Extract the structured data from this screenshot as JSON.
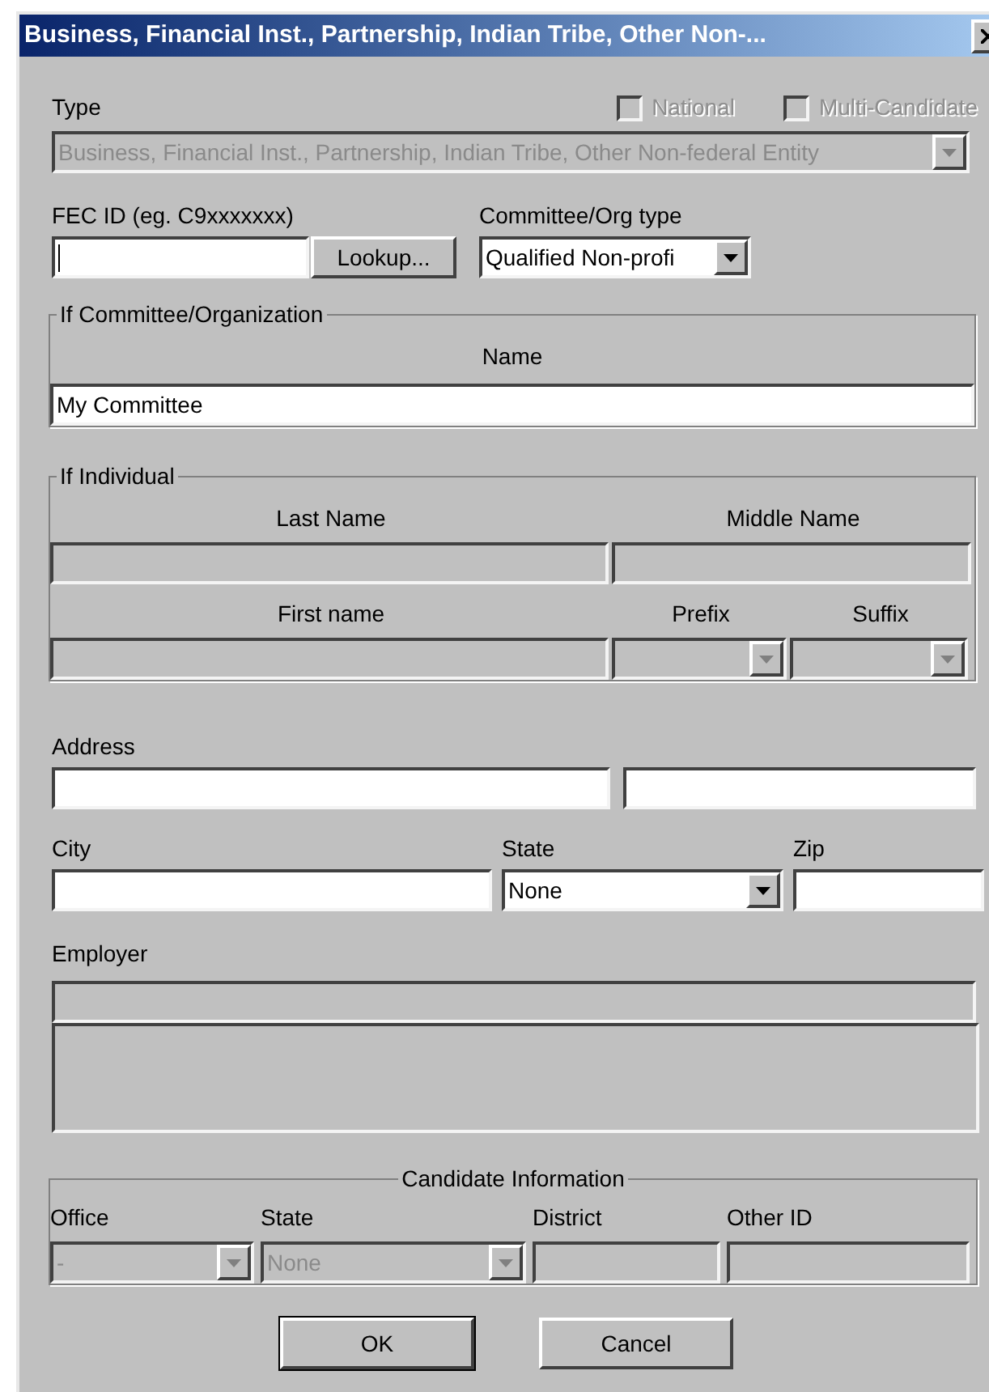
{
  "window": {
    "title": "Business, Financial Inst., Partnership, Indian Tribe, Other Non-..."
  },
  "type_section": {
    "label": "Type",
    "options": [
      {
        "label": "National",
        "checked": false,
        "disabled": true
      },
      {
        "label": "Multi-Candidate",
        "checked": false,
        "disabled": true
      }
    ],
    "field": {
      "kind": "dropdown",
      "value": "Business, Financial Inst., Partnership, Indian Tribe, Other Non-federal Entity",
      "disabled": true
    }
  },
  "fec_id": {
    "label": "FEC ID (eg. C9xxxxxxx)",
    "field": {
      "kind": "text",
      "disabled": false,
      "focused": true
    },
    "button": "Lookup..."
  },
  "org_type": {
    "label": "Committee/Org type",
    "field": {
      "kind": "dropdown",
      "value": "Qualified Non-profi",
      "disabled": false
    }
  },
  "committee": {
    "title": "If Committee/Organization",
    "label": "Name",
    "field": {
      "kind": "text",
      "value": "My Committee",
      "disabled": false
    }
  },
  "individual": {
    "title": "If Individual",
    "rows": [
      [
        {
          "label": "Last Name",
          "field": {
            "kind": "text",
            "disabled": true
          }
        },
        {
          "label": "Middle Name",
          "field": {
            "kind": "text",
            "disabled": true
          }
        }
      ],
      [
        {
          "label": "First name",
          "field": {
            "kind": "text",
            "disabled": true
          }
        },
        {
          "label": "Prefix",
          "field": {
            "kind": "dropdown",
            "disabled": true
          }
        },
        {
          "label": "Suffix",
          "field": {
            "kind": "dropdown",
            "disabled": true
          }
        }
      ]
    ]
  },
  "address": {
    "label": "Address",
    "fields": [
      {
        "kind": "text",
        "disabled": false
      },
      {
        "kind": "text",
        "disabled": false
      }
    ]
  },
  "city_row": [
    {
      "label": "City",
      "field": {
        "kind": "text",
        "disabled": false
      }
    },
    {
      "label": "State",
      "field": {
        "kind": "dropdown",
        "value": "None",
        "disabled": false
      }
    },
    {
      "label": "Zip",
      "field": {
        "kind": "text",
        "disabled": false
      }
    }
  ],
  "employer": {
    "label": "Employer",
    "fields": [
      {
        "kind": "text",
        "disabled": true
      },
      {
        "kind": "memo",
        "disabled": true
      }
    ]
  },
  "candidate": {
    "title": "Candidate Information",
    "columns": [
      {
        "label": "Office",
        "field": {
          "kind": "dropdown",
          "value": "-",
          "disabled": true
        }
      },
      {
        "label": "State",
        "field": {
          "kind": "dropdown",
          "value": "None",
          "disabled": true
        }
      },
      {
        "label": "District",
        "field": {
          "kind": "text",
          "disabled": true
        }
      },
      {
        "label": "Other ID",
        "field": {
          "kind": "text",
          "disabled": true
        }
      }
    ]
  },
  "buttons": [
    {
      "label": "OK",
      "default": true
    },
    {
      "label": "Cancel",
      "default": false
    }
  ]
}
